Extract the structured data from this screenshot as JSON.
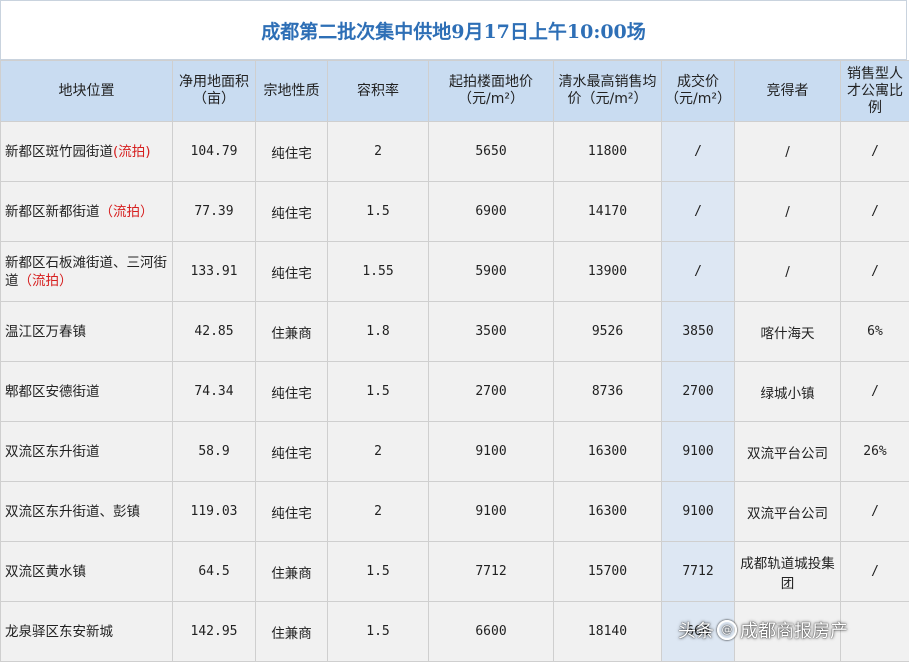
{
  "title": "成都第二批次集中供地9月17日上午10:00场",
  "columns": [
    "地块位置",
    "净用地面积（亩）",
    "宗地性质",
    "容积率",
    "起拍楼面地价（元/m²）",
    "清水最高销售均价（元/m²）",
    "成交价（元/m²）",
    "竞得者",
    "销售型人才公寓比例"
  ],
  "rows": [
    {
      "location": "新都区斑竹园街道",
      "tag": "(流拍)",
      "area": "104.79",
      "nature": "纯住宅",
      "far": "2",
      "start_price": "5650",
      "max_sale": "11800",
      "deal": "/",
      "winner": "/",
      "ratio": "/"
    },
    {
      "location": "新都区新都街道",
      "tag": "（流拍）",
      "area": "77.39",
      "nature": "纯住宅",
      "far": "1.5",
      "start_price": "6900",
      "max_sale": "14170",
      "deal": "/",
      "winner": "/",
      "ratio": "/"
    },
    {
      "location": "新都区石板滩街道、三河街道",
      "tag": "（流拍）",
      "area": "133.91",
      "nature": "纯住宅",
      "far": "1.55",
      "start_price": "5900",
      "max_sale": "13900",
      "deal": "/",
      "winner": "/",
      "ratio": "/"
    },
    {
      "location": "温江区万春镇",
      "tag": "",
      "area": "42.85",
      "nature": "住兼商",
      "far": "1.8",
      "start_price": "3500",
      "max_sale": "9526",
      "deal": "3850",
      "winner": "喀什海天",
      "ratio": "6%"
    },
    {
      "location": "郫都区安德街道",
      "tag": "",
      "area": "74.34",
      "nature": "纯住宅",
      "far": "1.5",
      "start_price": "2700",
      "max_sale": "8736",
      "deal": "2700",
      "winner": "绿城小镇",
      "ratio": "/"
    },
    {
      "location": "双流区东升街道",
      "tag": "",
      "area": "58.9",
      "nature": "纯住宅",
      "far": "2",
      "start_price": "9100",
      "max_sale": "16300",
      "deal": "9100",
      "winner": "双流平台公司",
      "ratio": "26%"
    },
    {
      "location": "双流区东升街道、彭镇",
      "tag": "",
      "area": "119.03",
      "nature": "纯住宅",
      "far": "2",
      "start_price": "9100",
      "max_sale": "16300",
      "deal": "9100",
      "winner": "双流平台公司",
      "ratio": "/"
    },
    {
      "location": "双流区黄水镇",
      "tag": "",
      "area": "64.5",
      "nature": "住兼商",
      "far": "1.5",
      "start_price": "7712",
      "max_sale": "15700",
      "deal": "7712",
      "winner": "成都轨道城投集团",
      "ratio": "/"
    },
    {
      "location": "龙泉驿区东安新城",
      "tag": "",
      "area": "142.95",
      "nature": "住兼商",
      "far": "1.5",
      "start_price": "6600",
      "max_sale": "18140",
      "deal": "660",
      "winner": "",
      "ratio": ""
    }
  ],
  "watermark": {
    "prefix": "头条",
    "name": "成都商报房产"
  },
  "colors": {
    "title": "#2e6fb6",
    "header_bg": "#c9dcf1",
    "cell_bg": "#f1f1f1",
    "deal_bg": "#dde7f3",
    "tag": "#d61f1f"
  }
}
